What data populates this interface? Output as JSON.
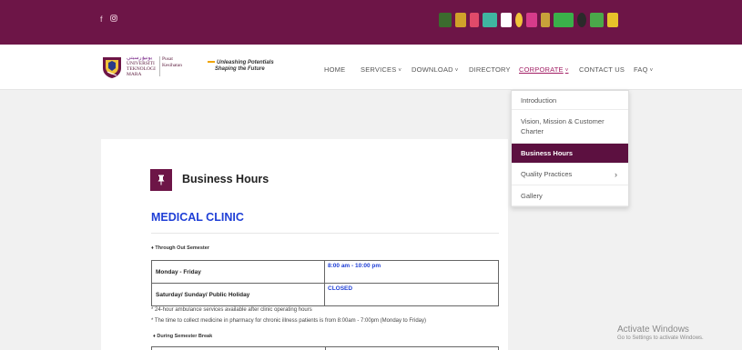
{
  "topbar": {
    "bg_color": "#6d1547",
    "social_icons": [
      "facebook-icon",
      "instagram-icon"
    ],
    "partner_logos": [
      {
        "name": "partner-logo-1",
        "color": "#3b6b2e"
      },
      {
        "name": "partner-logo-2",
        "color": "#d0a12a"
      },
      {
        "name": "partner-logo-3",
        "color": "#e04a6a"
      },
      {
        "name": "partner-logo-4",
        "color": "#3fb5a0"
      },
      {
        "name": "partner-logo-5",
        "color": "#ffffff"
      },
      {
        "name": "partner-logo-6",
        "color": "#f0c43a"
      },
      {
        "name": "partner-logo-7",
        "color": "#d63b8a"
      },
      {
        "name": "partner-logo-8",
        "color": "#c7a23a"
      },
      {
        "name": "partner-logo-9",
        "color": "#3ab04a"
      },
      {
        "name": "partner-logo-10",
        "color": "#2a2a2a"
      },
      {
        "name": "partner-logo-11",
        "color": "#4aa84a"
      },
      {
        "name": "partner-logo-12",
        "color": "#e7c22a"
      }
    ]
  },
  "brand": {
    "arabic_text": "يونيۏرسيتي",
    "university_lines": [
      "UNIVERSITI",
      "TEKNOLOGI",
      "MARA"
    ],
    "pusat_lines": [
      "Pusat",
      "Kesihatan"
    ],
    "slogan_line1": "Unleashing Potentials",
    "slogan_line2": "Shaping the Future",
    "accent_color": "#a21f65"
  },
  "nav": {
    "items": [
      {
        "label": "HOME",
        "has_caret": false,
        "active": false
      },
      {
        "label": "SERVICES",
        "has_caret": true,
        "active": false
      },
      {
        "label": "DOWNLOAD",
        "has_caret": true,
        "active": false
      },
      {
        "label": "DIRECTORY",
        "has_caret": false,
        "active": false
      },
      {
        "label": "CORPORATE",
        "has_caret": true,
        "active": true
      },
      {
        "label": "CONTACT US",
        "has_caret": false,
        "active": false
      },
      {
        "label": "FAQ",
        "has_caret": true,
        "active": false
      }
    ]
  },
  "dropdown": {
    "items": [
      {
        "label": "Introduction",
        "active": false,
        "has_submenu": false
      },
      {
        "label": "Vision, Mission & Customer Charter",
        "active": false,
        "has_submenu": false
      },
      {
        "label": "Business Hours",
        "active": true,
        "has_submenu": false
      },
      {
        "label": "Quality Practices",
        "active": false,
        "has_submenu": true
      },
      {
        "label": "Gallery",
        "active": false,
        "has_submenu": false
      }
    ]
  },
  "content": {
    "page_title": "Business Hours",
    "page_icon": "pin-icon",
    "clinic_title": "MEDICAL CLINIC",
    "semester_label": "Through Out Semester",
    "hours": [
      {
        "day": "Monday - Friday",
        "time": "8:00 am - 10:00 pm"
      },
      {
        "day": "Saturday/ Sunday/ Public Holiday",
        "time": "CLOSED"
      }
    ],
    "notes": [
      "* 24-hour ambulance services available after clinic operating hours",
      "* The time to collect medicine in pharmacy for chronic illness patients is from 8:00am - 7:00pm (Monday to Friday)"
    ],
    "break_label": "During Semester Break",
    "link_color": "#1f3fd6"
  },
  "watermark": {
    "line1": "Activate Windows",
    "line2": "Go to Settings to activate Windows."
  }
}
